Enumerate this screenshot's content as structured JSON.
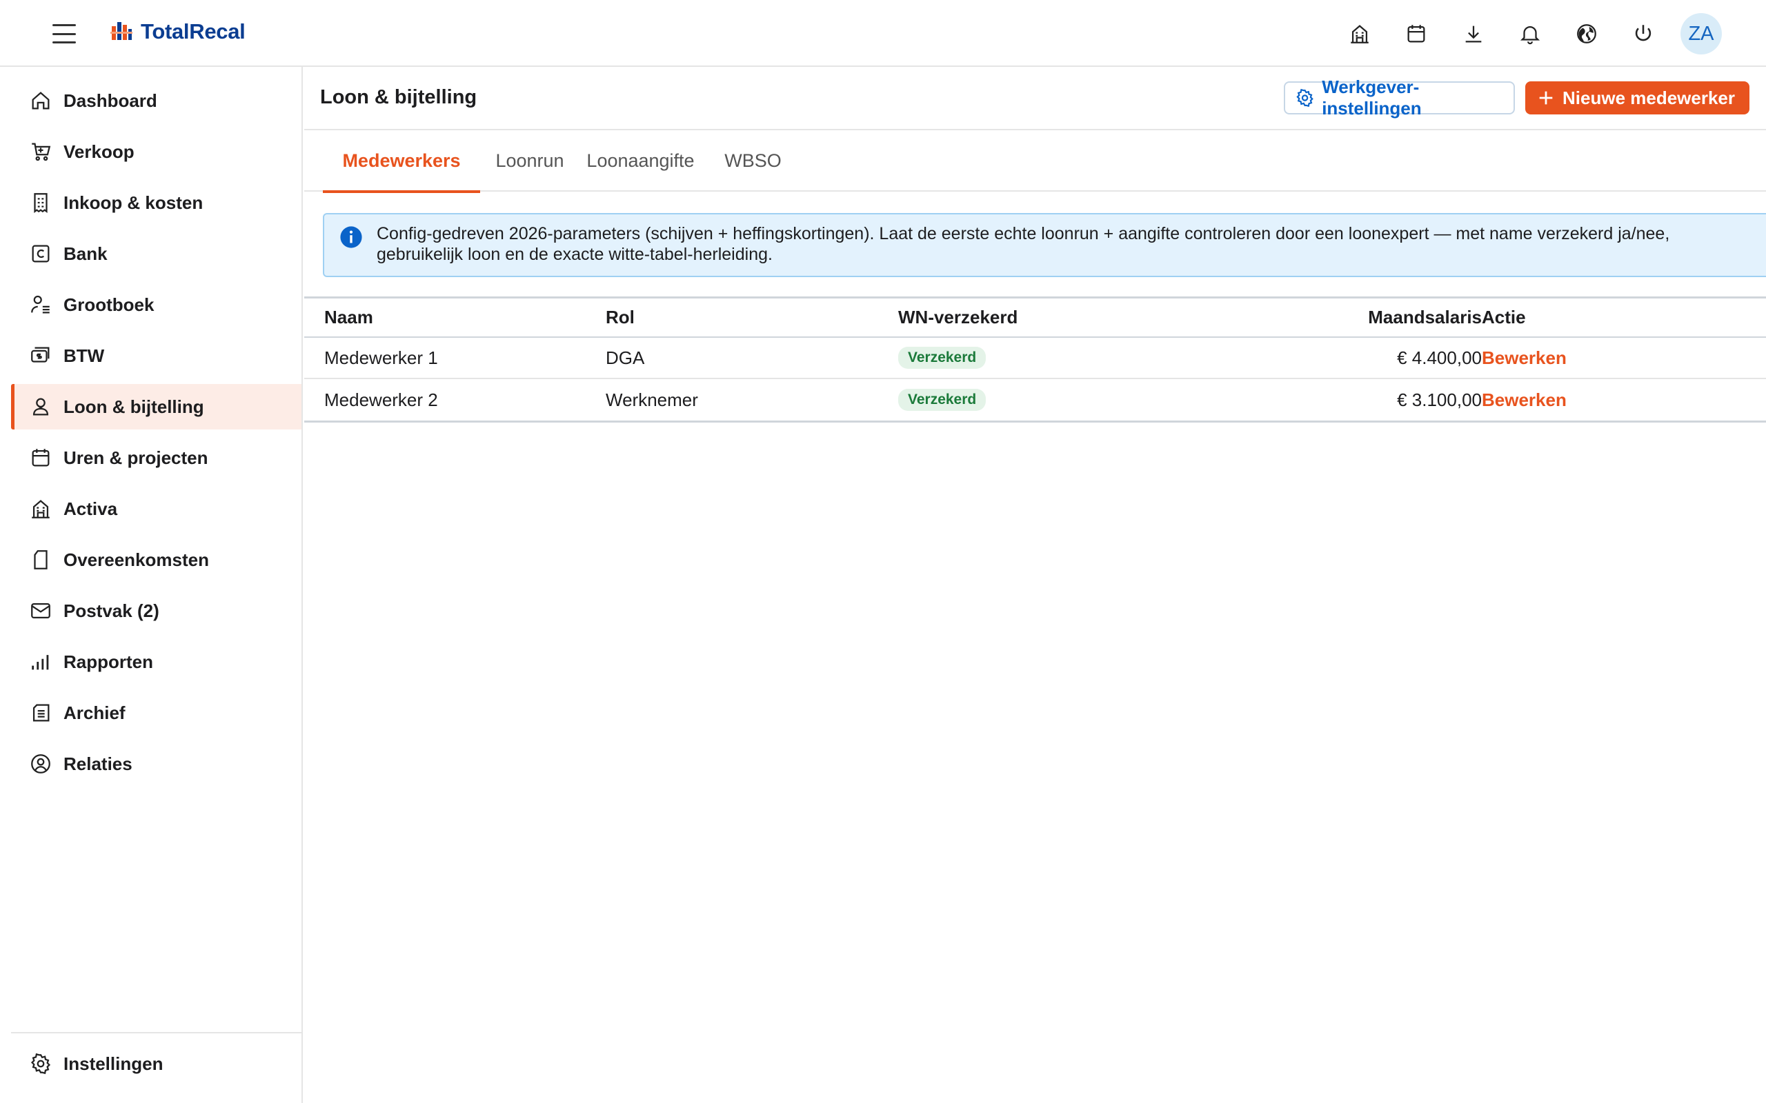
{
  "app": {
    "brand": "TotalRecal",
    "user_initials": "ZA"
  },
  "topbar": {
    "icons": [
      "building-icon",
      "calendar-icon",
      "download-icon",
      "bell-icon",
      "globe-icon",
      "power-icon"
    ]
  },
  "sidebar": {
    "items": [
      {
        "label": "Dashboard",
        "icon": "home-icon"
      },
      {
        "label": "Verkoop",
        "icon": "cart-icon"
      },
      {
        "label": "Inkoop & kosten",
        "icon": "receipt-icon"
      },
      {
        "label": "Bank",
        "icon": "bank-card-icon"
      },
      {
        "label": "Grootboek",
        "icon": "ledger-icon"
      },
      {
        "label": "BTW",
        "icon": "tax-icon"
      },
      {
        "label": "Loon & bijtelling",
        "icon": "person-icon",
        "active": true
      },
      {
        "label": "Uren & projecten",
        "icon": "calendar-icon"
      },
      {
        "label": "Activa",
        "icon": "building-icon"
      },
      {
        "label": "Overeenkomsten",
        "icon": "document-icon"
      },
      {
        "label": "Postvak (2)",
        "icon": "mail-icon"
      },
      {
        "label": "Rapporten",
        "icon": "bar-chart-icon"
      },
      {
        "label": "Archief",
        "icon": "archive-icon"
      },
      {
        "label": "Relaties",
        "icon": "contact-icon"
      }
    ],
    "settings_label": "Instellingen"
  },
  "main": {
    "title": "Loon & bijtelling",
    "employer_settings_label": "Werkgever-instellingen",
    "new_employee_label": "Nieuwe medewerker",
    "tabs": [
      {
        "label": "Medewerkers",
        "active": true
      },
      {
        "label": "Loonrun"
      },
      {
        "label": "Loonaangifte"
      },
      {
        "label": "WBSO"
      }
    ],
    "info_text": "Config-gedreven 2026-parameters (schijven + heffingskortingen). Laat de eerste echte loonrun + aangifte controleren door een loonexpert — met name verzekerd ja/nee, gebruikelijk loon en de exacte witte-tabel-herleiding.",
    "table": {
      "headers": {
        "naam": "Naam",
        "rol": "Rol",
        "wn": "WN-verzekerd",
        "salaris": "Maandsalaris",
        "actie": "Actie"
      },
      "rows": [
        {
          "naam": "Medewerker 1",
          "rol": "DGA",
          "wn": "Verzekerd",
          "salaris": "€ 4.400,00",
          "actie": "Bewerken"
        },
        {
          "naam": "Medewerker 2",
          "rol": "Werknemer",
          "wn": "Verzekerd",
          "salaris": "€ 3.100,00",
          "actie": "Bewerken"
        }
      ]
    }
  },
  "colors": {
    "accent": "#e8531e",
    "link_blue": "#0a63c9",
    "brand_blue": "#0b3d91",
    "info_bg": "#e3f2fd",
    "badge_green": "#1b7a3a"
  }
}
